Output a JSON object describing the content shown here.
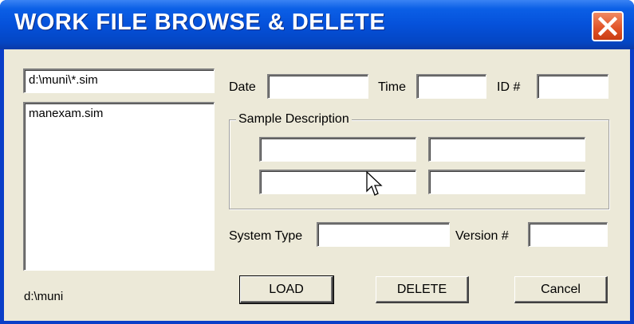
{
  "window": {
    "title": "WORK FILE BROWSE & DELETE",
    "close_icon": "close-x-icon"
  },
  "file_pane": {
    "filter_value": "d:\\muni\\*.sim",
    "files": [
      "manexam.sim"
    ],
    "current_dir": "d:\\muni"
  },
  "header_fields": {
    "date_label": "Date",
    "date_value": "",
    "time_label": "Time",
    "time_value": "",
    "id_label": "ID #",
    "id_value": ""
  },
  "sample_description": {
    "label": "Sample Description",
    "fields": [
      "",
      "",
      "",
      ""
    ]
  },
  "system": {
    "system_type_label": "System Type",
    "system_type_value": "",
    "version_label": "Version #",
    "version_value": ""
  },
  "buttons": {
    "load": "LOAD",
    "delete": "DELETE",
    "cancel": "Cancel"
  },
  "colors": {
    "titlebar": "#0551da",
    "dialog_face": "#ece9d8",
    "close_button": "#e2552a"
  }
}
